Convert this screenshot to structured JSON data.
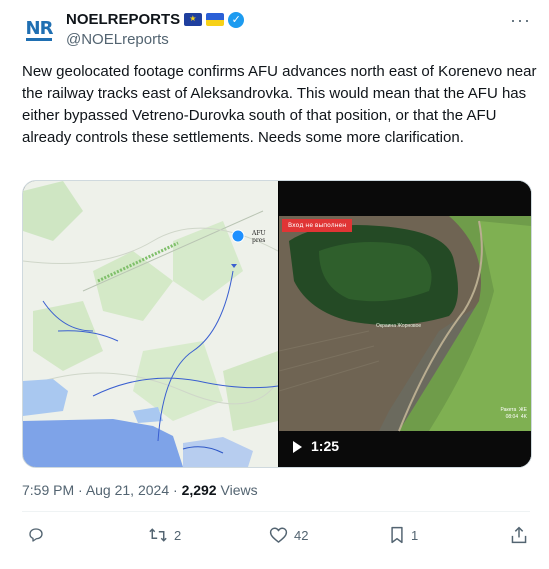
{
  "author": {
    "display_name": "NOELREPORTS",
    "handle": "@NOELreports",
    "avatar_text": "NR",
    "flags": [
      "eu-flag-icon",
      "ukraine-flag-icon"
    ],
    "verified": true
  },
  "tweet": {
    "text": "New geolocated footage confirms AFU advances north east of Korenevo near the railway tracks east of Aleksandrovka. This would mean that the AFU has either bypassed Vetreno-Durovka south of that position, or that the AFU already controls these settlements. Needs some more clarification."
  },
  "media": {
    "map_afu_label": "AFU pres",
    "video_banner": "Вход не выполнен",
    "video_field_label": "Окраина Жорновое",
    "video_hud": "Ракета  ЖЕ\n08:04  4K",
    "duration": "1:25"
  },
  "meta": {
    "time": "7:59 PM",
    "separator": " · ",
    "date": "Aug 21, 2024",
    "views_count": "2,292",
    "views_label": " Views"
  },
  "actions": {
    "replies": "",
    "retweets": "2",
    "likes": "42",
    "bookmarks": "1"
  },
  "colors": {
    "verified": "#1d9bf0",
    "text": "#0f1419",
    "secondary": "#536471",
    "map_marker": "#1e90ff"
  }
}
